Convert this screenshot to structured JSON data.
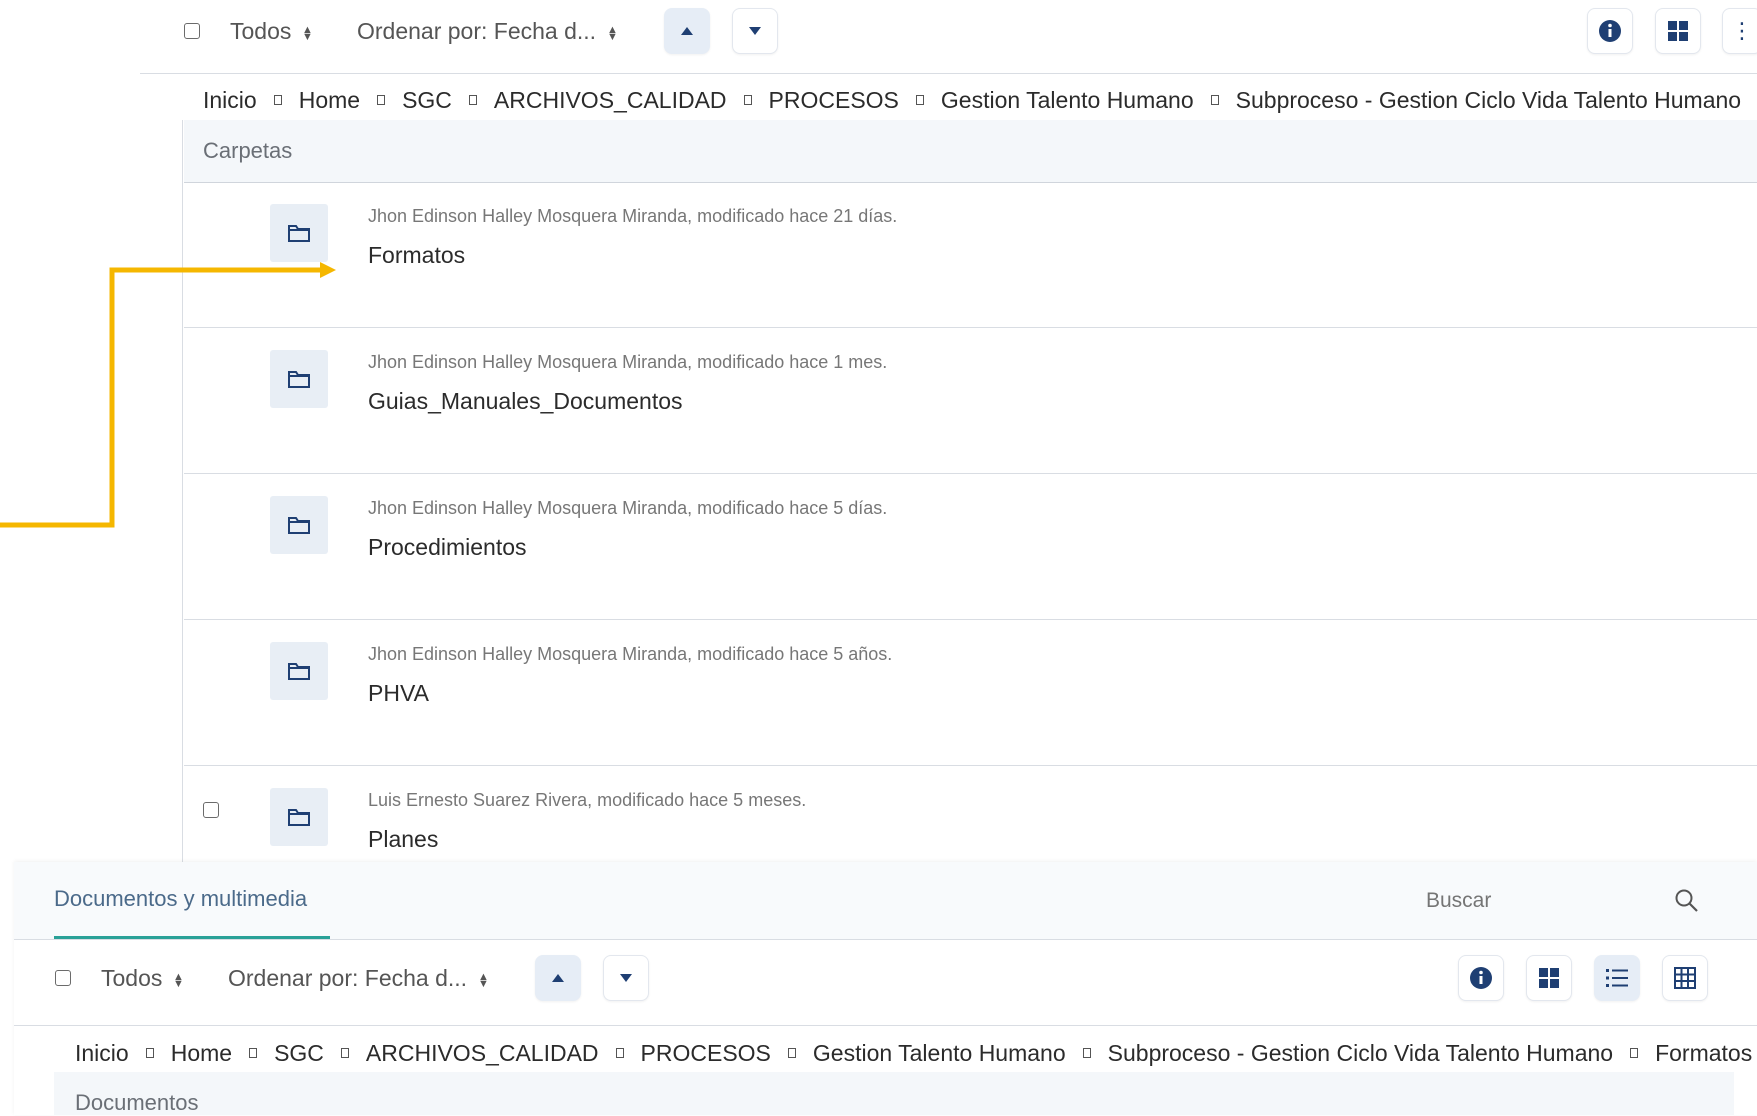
{
  "top_toolbar": {
    "select_all_label": "Todos",
    "sort_label": "Ordenar por: Fecha d..."
  },
  "top_breadcrumb": [
    "Inicio",
    "Home",
    "SGC",
    "ARCHIVOS_CALIDAD",
    "PROCESOS",
    "Gestion Talento Humano",
    "Subproceso - Gestion Ciclo Vida Talento Humano"
  ],
  "folders_section": {
    "title": "Carpetas",
    "items": [
      {
        "meta": "Jhon Edinson Halley Mosquera Miranda, modificado hace 21 días.",
        "name": "Formatos"
      },
      {
        "meta": "Jhon Edinson Halley Mosquera Miranda, modificado hace 1 mes.",
        "name": "Guias_Manuales_Documentos"
      },
      {
        "meta": "Jhon Edinson Halley Mosquera Miranda, modificado hace 5 días.",
        "name": "Procedimientos"
      },
      {
        "meta": "Jhon Edinson Halley Mosquera Miranda, modificado hace 5 años.",
        "name": "PHVA"
      },
      {
        "meta": "Luis Ernesto Suarez Rivera, modificado hace 5 meses.",
        "name": "Planes"
      }
    ]
  },
  "docs_panel": {
    "tab_label": "Documentos y multimedia",
    "search_placeholder": "Buscar",
    "select_all_label": "Todos",
    "sort_label": "Ordenar por: Fecha d...",
    "breadcrumb": [
      "Inicio",
      "Home",
      "SGC",
      "ARCHIVOS_CALIDAD",
      "PROCESOS",
      "Gestion Talento Humano",
      "Subproceso - Gestion Ciclo Vida Talento Humano",
      "Formatos"
    ],
    "section_title": "Documentos"
  },
  "colors": {
    "accent_teal": "#2aa198",
    "icon_navy": "#1f3f73",
    "annotation_arrow": "#f5b700",
    "button_blue_bg": "#e6edf6"
  },
  "icons": {
    "info": "info-icon",
    "grid": "grid-view-icon",
    "list": "list-view-icon",
    "table": "table-view-icon",
    "search": "search-icon",
    "folder": "folder-icon"
  }
}
